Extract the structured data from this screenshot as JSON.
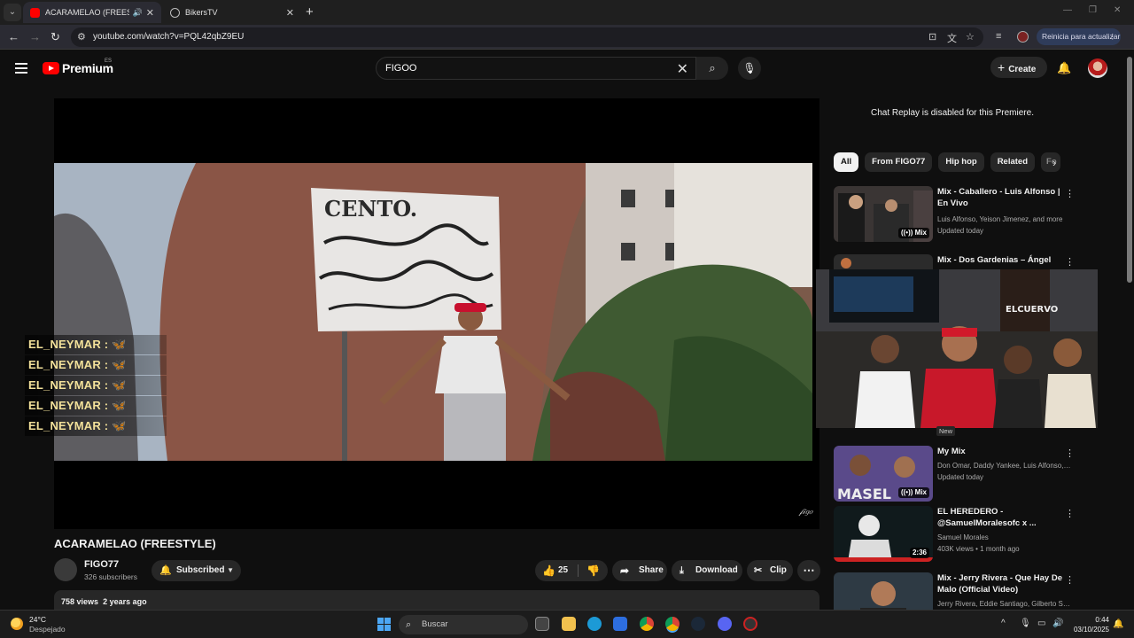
{
  "browser": {
    "tabs": [
      {
        "title": "ACARAMELAO (FREESTYLE)",
        "active": true
      },
      {
        "title": "BikersTV",
        "active": false
      }
    ],
    "url": "youtube.com/watch?v=PQL42qbZ9EU",
    "update_label": "Reinicia para actualizar"
  },
  "masthead": {
    "logo_text": "Premium",
    "country_code": "ES",
    "search_query": "FIGOO",
    "create_label": "Create"
  },
  "player": {
    "chat_overlay": [
      "EL_NEYMAR :",
      "EL_NEYMAR :",
      "EL_NEYMAR :",
      "EL_NEYMAR :",
      "EL_NEYMAR :"
    ]
  },
  "video": {
    "title": "ACARAMELAO (FREESTYLE)",
    "channel": "FIGO77",
    "subscribers": "326 subscribers",
    "subscribed_label": "Subscribed",
    "likes": "25",
    "share_label": "Share",
    "download_label": "Download",
    "clip_label": "Clip",
    "views": "758 views",
    "age": "2 years ago"
  },
  "sidebar": {
    "chat_replay_msg": "Chat Replay is disabled for this Premiere.",
    "chips": [
      "All",
      "From FIGO77",
      "Hip hop",
      "Related",
      "Fo"
    ],
    "recommendations": [
      {
        "title": "Mix - Caballero - Luis Alfonso | En Vivo",
        "line1": "Luis Alfonso, Yeison Jimenez, and more",
        "line2": "Updated today",
        "badge": "Mix"
      },
      {
        "title": "Mix - Dos Gardenias – Ángel",
        "line1": "",
        "line2": "",
        "badge": ""
      },
      {
        "title": "My Mix",
        "line1": "Don Omar, Daddy Yankee, Luis Alfonso, a...",
        "line2": "Updated today",
        "badge": "Mix"
      },
      {
        "title": "EL HEREDERO - @SamuelMoralesofc x ...",
        "line1": "Samuel Morales",
        "line2": "403K views • 1 month ago",
        "badge": "2:36"
      },
      {
        "title": "Mix - Jerry Rivera - Que Hay De Malo (Official Video)",
        "line1": "Jerry Rivera, Eddie Santiago, Gilberto Sa...",
        "line2": "",
        "badge": ""
      }
    ],
    "new_badge": "New"
  },
  "taskbar": {
    "temperature": "24°C",
    "weather": "Despejado",
    "search_placeholder": "Buscar",
    "time": "0:44",
    "date": "03/10/2025"
  }
}
